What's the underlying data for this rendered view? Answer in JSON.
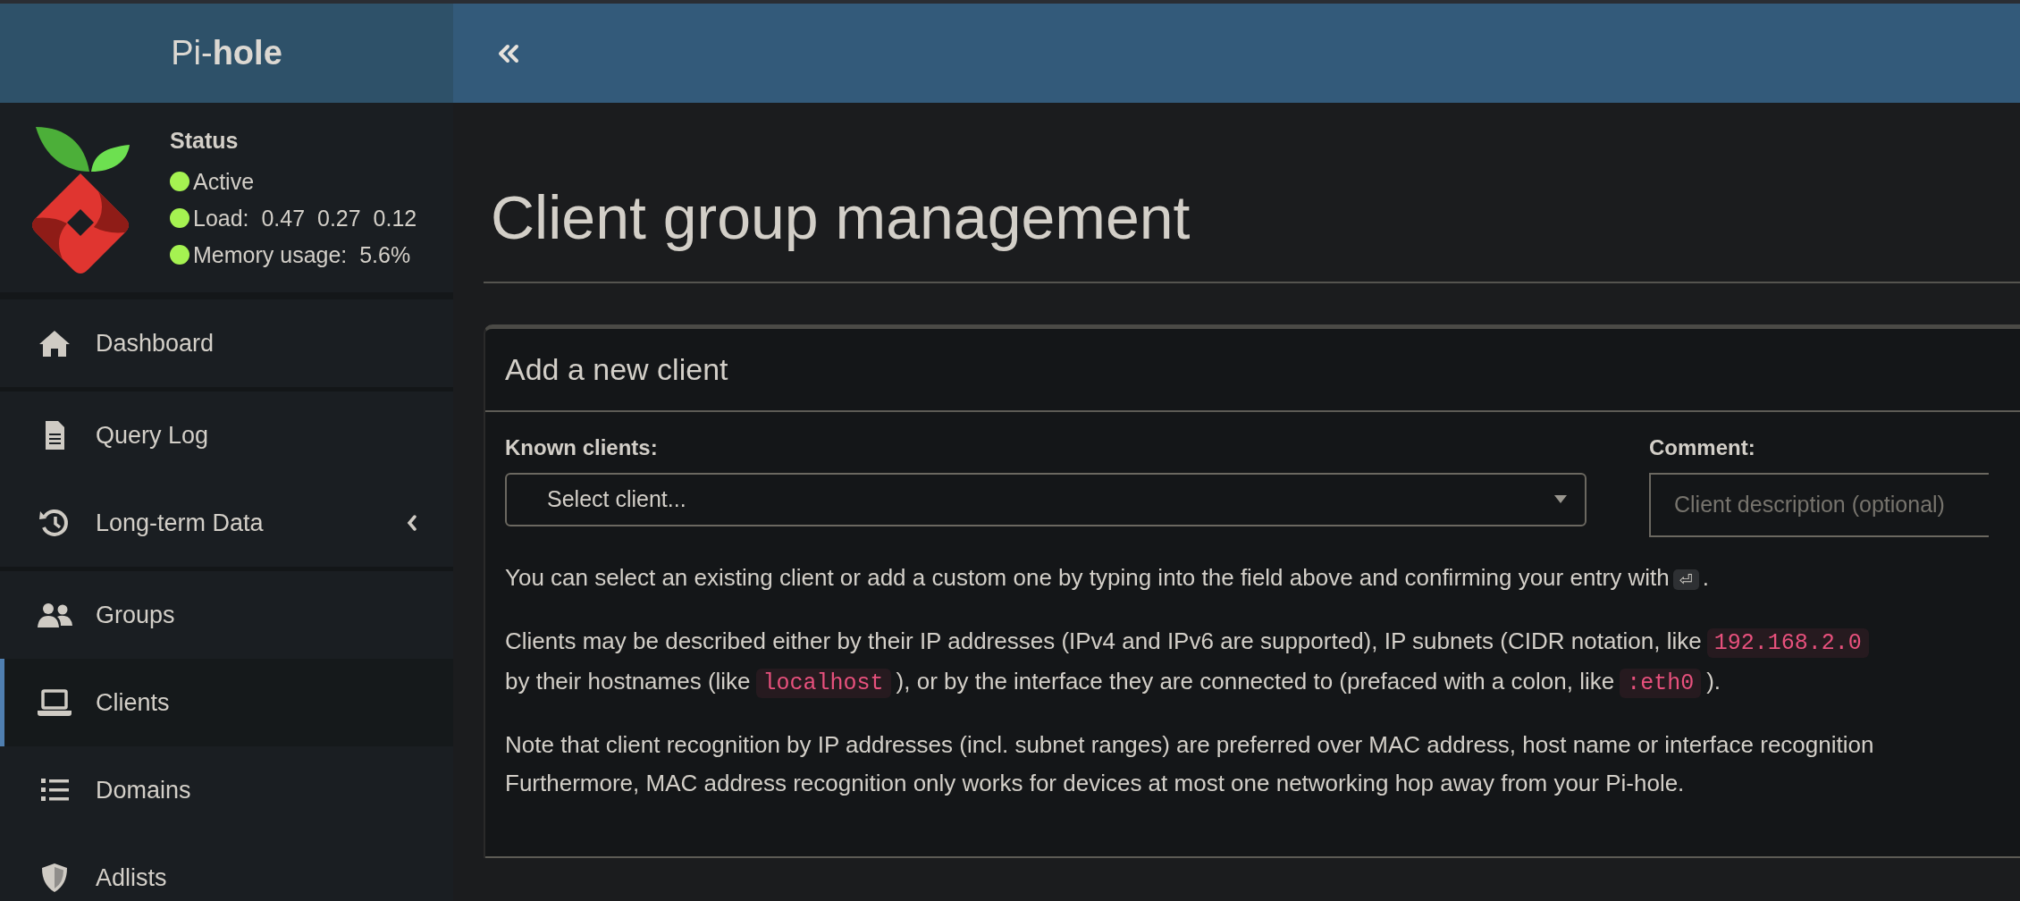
{
  "brand": "Pi-**hole**",
  "status": {
    "title": "Status",
    "items": [
      {
        "label": "Active",
        "color": "#a5f251"
      },
      {
        "label": "Load:  0.47  0.27  0.12",
        "color": "#a5f251"
      },
      {
        "label": "Memory usage:  5.6%",
        "color": "#a5f251"
      }
    ]
  },
  "menu_sections": [
    [
      {
        "label": "Dashboard",
        "selected": false,
        "expandable": false
      }
    ],
    [
      {
        "label": "Query Log",
        "selected": false,
        "expandable": false
      },
      {
        "label": "Long-term Data",
        "selected": false,
        "expandable": true
      }
    ],
    [
      {
        "label": "Groups",
        "selected": false,
        "expandable": false
      },
      {
        "label": "Clients",
        "selected": true,
        "expandable": false
      },
      {
        "label": "Domains",
        "selected": false,
        "expandable": false
      },
      {
        "label": "Adlists",
        "selected": false,
        "expandable": false
      }
    ]
  ],
  "page_title": "Client group management",
  "card": {
    "title": "Add a new client",
    "known_clients": {
      "label": "Known clients:",
      "value": "Select client..."
    },
    "comment": {
      "label": "Comment:",
      "placeholder": "Client description (optional)"
    },
    "help": [
      [
        [
          {
            "kind": "text",
            "text": "You can select an existing client or add a custom one by typing into the field above and confirming your entry with"
          },
          {
            "kind": "key",
            "text": "⏎"
          },
          {
            "kind": "text",
            "text": "."
          }
        ]
      ],
      [
        [
          {
            "kind": "text",
            "text": "Clients may be described either by their IP addresses (IPv4 and IPv6 are supported), IP subnets (CIDR notation, like"
          },
          {
            "kind": "code",
            "text": "192.168.2.0"
          }
        ],
        [
          {
            "kind": "text",
            "text": "by their hostnames (like"
          },
          {
            "kind": "code",
            "text": "localhost"
          },
          {
            "kind": "text",
            "text": "), or by the interface they are connected to (prefaced with a colon, like"
          },
          {
            "kind": "code",
            "text": ":eth0"
          },
          {
            "kind": "text",
            "text": ")."
          }
        ]
      ],
      [
        [
          {
            "kind": "text",
            "text": "Note that client recognition by IP addresses (incl. subnet ranges) are preferred over MAC address, host name or interface recognition"
          }
        ],
        [
          {
            "kind": "text",
            "text": "Furthermore, MAC address recognition only works for devices at most one networking hop away from your Pi-hole."
          }
        ]
      ]
    ]
  }
}
